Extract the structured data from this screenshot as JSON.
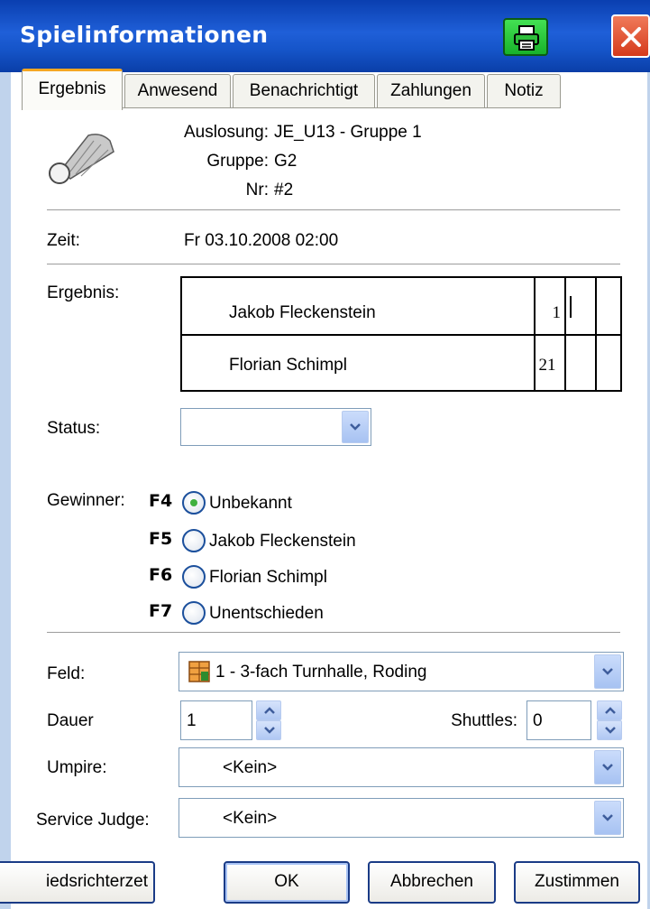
{
  "window": {
    "title": "Spielinformationen"
  },
  "tabs": [
    {
      "label": "Ergebnis",
      "active": true
    },
    {
      "label": "Anwesend"
    },
    {
      "label": "Benachrichtigt"
    },
    {
      "label": "Zahlungen"
    },
    {
      "label": "Notiz"
    }
  ],
  "match": {
    "draw_label": "Auslosung:",
    "draw_value": "JE_U13 - Gruppe 1",
    "group_label": "Gruppe:",
    "group_value": "G2",
    "nr_label": "Nr:",
    "nr_value": "#2"
  },
  "time": {
    "label": "Zeit:",
    "value": "Fr 03.10.2008 02:00"
  },
  "result": {
    "label": "Ergebnis:",
    "players": [
      {
        "name": "Jakob Fleckenstein",
        "score": "1"
      },
      {
        "name": "Florian Schimpl",
        "score": "21"
      }
    ]
  },
  "status": {
    "label": "Status:",
    "value": ""
  },
  "winner": {
    "label": "Gewinner:",
    "options": [
      {
        "key": "F4",
        "label": "Unbekannt",
        "selected": true
      },
      {
        "key": "F5",
        "label": "Jakob Fleckenstein",
        "selected": false
      },
      {
        "key": "F6",
        "label": "Florian Schimpl",
        "selected": false
      },
      {
        "key": "F7",
        "label": "Unentschieden",
        "selected": false
      }
    ]
  },
  "court": {
    "label": "Feld:",
    "value": "1 - 3-fach Turnhalle, Roding",
    "icon": "court-icon"
  },
  "duration": {
    "label": "Dauer",
    "value": "1"
  },
  "shuttles": {
    "label": "Shuttles:",
    "value": "0"
  },
  "umpire": {
    "label": "Umpire:",
    "value": "<Kein>"
  },
  "service_judge": {
    "label": "Service Judge:",
    "value": "<Kein>"
  },
  "buttons": {
    "umpire_sheet": "iedsrichterzet",
    "ok": "OK",
    "cancel": "Abbrechen",
    "approve": "Zustimmen"
  },
  "colors": {
    "titlebar": "#1554c8",
    "tab_accent": "#f5a623",
    "radio_selected": "#3fb13f"
  }
}
